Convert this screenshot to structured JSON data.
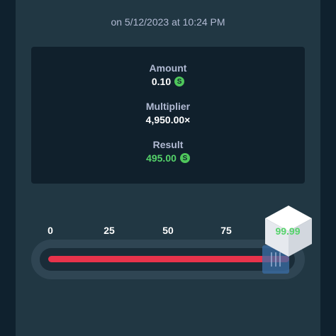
{
  "bet": {
    "date_line": "on 5/12/2023 at 10:24 PM",
    "amount_label": "Amount",
    "amount_value": "0.10",
    "multiplier_label": "Multiplier",
    "multiplier_value": "4,950.00×",
    "result_label": "Result",
    "result_value": "495.00",
    "currency_symbol": "S"
  },
  "slider": {
    "ticks": [
      "0",
      "25",
      "50",
      "75"
    ],
    "value": 99.99,
    "roll_result": "99.99"
  },
  "colors": {
    "background": "#0f212e",
    "panel": "#213743",
    "win_green": "#55d36a",
    "lose_red": "#e8334b",
    "coin_green": "#4fc75b"
  },
  "icons": {
    "coin": "coin-icon",
    "dice": "dice-icon"
  }
}
